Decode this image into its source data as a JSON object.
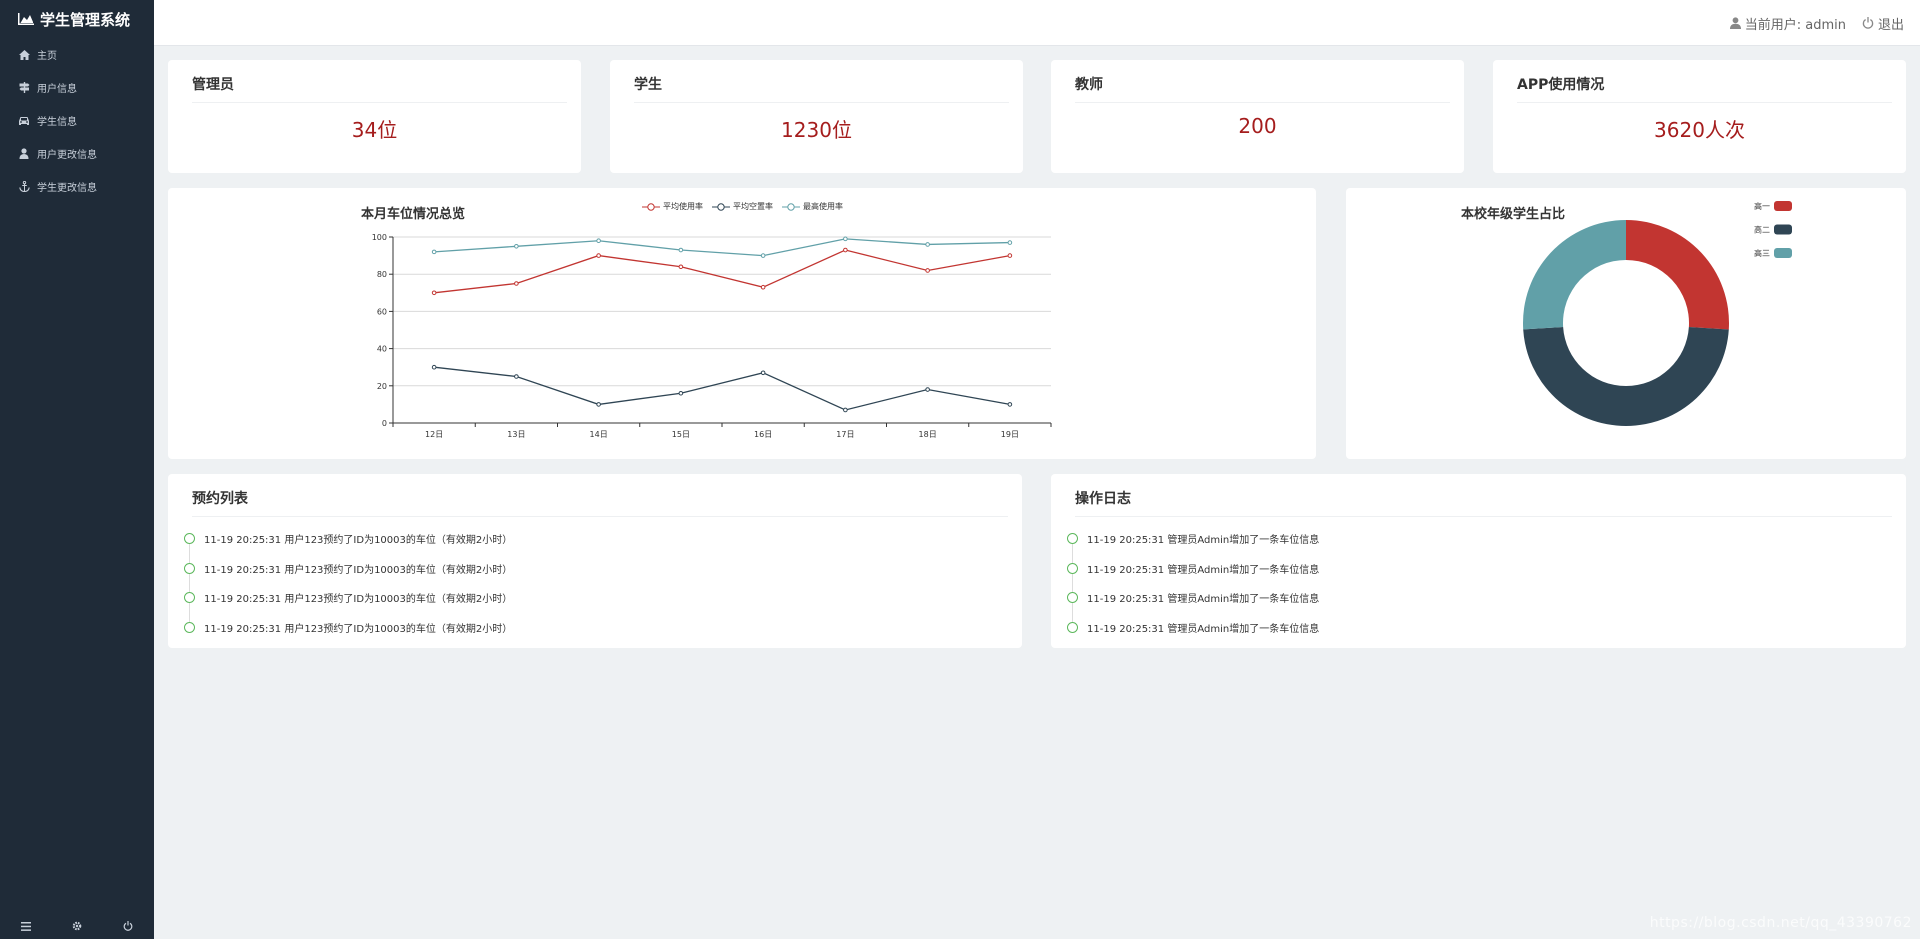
{
  "app": {
    "title": "学生管理系统"
  },
  "sidebar": {
    "items": [
      {
        "label": "主页",
        "icon": "home-icon"
      },
      {
        "label": "用户信息",
        "icon": "signpost-icon"
      },
      {
        "label": "学生信息",
        "icon": "car-icon"
      },
      {
        "label": "用户更改信息",
        "icon": "user-icon"
      },
      {
        "label": "学生更改信息",
        "icon": "anchor-icon"
      }
    ],
    "footer_icons": [
      "menu-icon",
      "gear-icon",
      "power-icon"
    ]
  },
  "header": {
    "user_label": "当前用户: admin",
    "logout_label": "退出"
  },
  "stats": [
    {
      "title": "管理员",
      "value": "34位"
    },
    {
      "title": "学生",
      "value": "1230位"
    },
    {
      "title": "教师",
      "value": "200"
    },
    {
      "title": "APP使用情况",
      "value": "3620人次"
    }
  ],
  "colors": {
    "sidebar_bg": "#1f2b38",
    "accent_red": "#c23531",
    "dark_slate": "#2f4554",
    "teal": "#61a0a8",
    "stat_value": "#a51d1d",
    "timeline_dot": "#5cb85c"
  },
  "chart_data": [
    {
      "type": "line",
      "title": "本月车位情况总览",
      "categories": [
        "12日",
        "13日",
        "14日",
        "15日",
        "16日",
        "17日",
        "18日",
        "19日"
      ],
      "ylim": [
        0,
        100
      ],
      "yticks": [
        0,
        20,
        40,
        60,
        80,
        100
      ],
      "grid": true,
      "legend_position": "top-center",
      "series": [
        {
          "name": "平均使用率",
          "color": "#c23531",
          "values": [
            70,
            75,
            90,
            84,
            73,
            93,
            82,
            90
          ]
        },
        {
          "name": "平均空置率",
          "color": "#2f4554",
          "values": [
            30,
            25,
            10,
            16,
            27,
            7,
            18,
            10
          ]
        },
        {
          "name": "最高使用率",
          "color": "#61a0a8",
          "values": [
            92,
            95,
            98,
            93,
            90,
            99,
            96,
            97
          ]
        }
      ]
    },
    {
      "type": "pie",
      "title": "本校年级学生占比",
      "legend_position": "top-right",
      "slices": [
        {
          "name": "高一",
          "color": "#c23531",
          "value": 26
        },
        {
          "name": "高二",
          "color": "#2f4554",
          "value": 48
        },
        {
          "name": "高三",
          "color": "#61a0a8",
          "value": 26
        }
      ]
    }
  ],
  "reservations": {
    "title": "预约列表",
    "items": [
      "11-19 20:25:31 用户123预约了ID为10003的车位（有效期2小时）",
      "11-19 20:25:31 用户123预约了ID为10003的车位（有效期2小时）",
      "11-19 20:25:31 用户123预约了ID为10003的车位（有效期2小时）",
      "11-19 20:25:31 用户123预约了ID为10003的车位（有效期2小时）"
    ]
  },
  "logs": {
    "title": "操作日志",
    "items": [
      "11-19 20:25:31 管理员Admin增加了一条车位信息",
      "11-19 20:25:31 管理员Admin增加了一条车位信息",
      "11-19 20:25:31 管理员Admin增加了一条车位信息",
      "11-19 20:25:31 管理员Admin增加了一条车位信息"
    ]
  },
  "watermark": "https://blog.csdn.net/qq_43390762"
}
